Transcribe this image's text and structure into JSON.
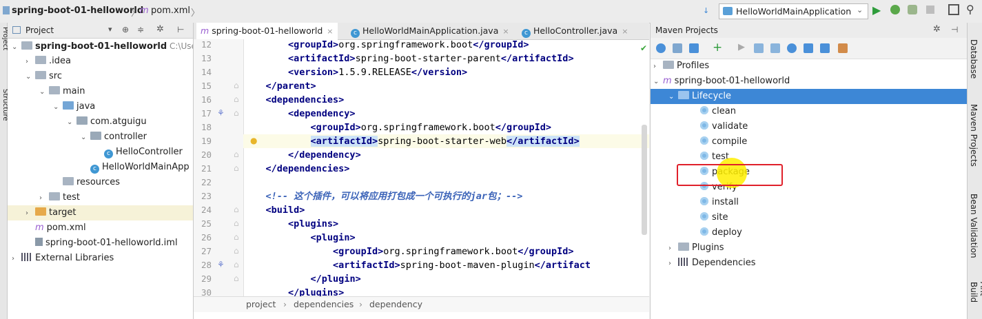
{
  "navbar": {
    "breadcrumb_project": "spring-boot-01-helloworld",
    "breadcrumb_file": "pom.xml",
    "run_config": "HelloWorldMainApplication"
  },
  "side_tabs": {
    "left": [
      "Project",
      "Structure"
    ],
    "right": [
      "Database",
      "Maven Projects",
      "Bean Validation",
      "Ant Build"
    ]
  },
  "project_panel": {
    "title": "Project",
    "tree": [
      {
        "label": "spring-boot-01-helloworld",
        "suffix": "C:\\Users",
        "arrow": "v",
        "icon": "folder",
        "bold": true
      },
      {
        "label": ".idea",
        "arrow": ">",
        "icon": "folder"
      },
      {
        "label": "src",
        "arrow": "v",
        "icon": "folder"
      },
      {
        "label": "main",
        "arrow": "v",
        "icon": "folder"
      },
      {
        "label": "java",
        "arrow": "v",
        "icon": "folder-blue"
      },
      {
        "label": "com.atguigu",
        "arrow": "v",
        "icon": "package"
      },
      {
        "label": "controller",
        "arrow": "v",
        "icon": "package"
      },
      {
        "label": "HelloController",
        "arrow": "",
        "icon": "class"
      },
      {
        "label": "HelloWorldMainApp",
        "arrow": "",
        "icon": "class"
      },
      {
        "label": "resources",
        "arrow": "",
        "icon": "folder"
      },
      {
        "label": "test",
        "arrow": ">",
        "icon": "folder"
      },
      {
        "label": "target",
        "arrow": ">",
        "icon": "folder-orange"
      },
      {
        "label": "pom.xml",
        "arrow": "",
        "icon": "maven"
      },
      {
        "label": "spring-boot-01-helloworld.iml",
        "arrow": "",
        "icon": "file"
      },
      {
        "label": "External Libraries",
        "arrow": ">",
        "icon": "library"
      }
    ]
  },
  "editor": {
    "tabs": [
      "spring-boot-01-helloworld",
      "HelloWorldMainApplication.java",
      "HelloController.java"
    ],
    "lines": [
      {
        "n": "12",
        "indent": "        ",
        "parts": [
          [
            "tg",
            "<groupId>"
          ],
          [
            "tx",
            "org.springframework.boot"
          ],
          [
            "tg",
            "</groupId>"
          ]
        ]
      },
      {
        "n": "13",
        "indent": "        ",
        "parts": [
          [
            "tg",
            "<artifactId>"
          ],
          [
            "tx",
            "spring-boot-starter-parent"
          ],
          [
            "tg",
            "</artifactId>"
          ]
        ]
      },
      {
        "n": "14",
        "indent": "        ",
        "parts": [
          [
            "tg",
            "<version>"
          ],
          [
            "tx",
            "1.5.9.RELEASE"
          ],
          [
            "tg",
            "</version>"
          ]
        ]
      },
      {
        "n": "15",
        "indent": "    ",
        "parts": [
          [
            "tg",
            "</parent>"
          ]
        ]
      },
      {
        "n": "16",
        "indent": "    ",
        "parts": [
          [
            "tg",
            "<dependencies>"
          ]
        ]
      },
      {
        "n": "17",
        "indent": "        ",
        "parts": [
          [
            "tg",
            "<dependency>"
          ]
        ]
      },
      {
        "n": "18",
        "indent": "            ",
        "parts": [
          [
            "tg",
            "<groupId>"
          ],
          [
            "tx",
            "org.springframework.boot"
          ],
          [
            "tg",
            "</groupId>"
          ]
        ]
      },
      {
        "n": "19",
        "indent": "            ",
        "parts": [
          [
            "tg hl",
            "<artifactId>"
          ],
          [
            "tx",
            "spring-boot-starter-web"
          ],
          [
            "tg hl",
            "</artifactId>"
          ]
        ]
      },
      {
        "n": "20",
        "indent": "        ",
        "parts": [
          [
            "tg",
            "</dependency>"
          ]
        ]
      },
      {
        "n": "21",
        "indent": "    ",
        "parts": [
          [
            "tg",
            "</dependencies>"
          ]
        ]
      },
      {
        "n": "22",
        "indent": "",
        "parts": []
      },
      {
        "n": "23",
        "indent": "    ",
        "parts": [
          [
            "cm",
            "<!-- 这个插件，可以将应用打包成一个可执行的jar包；-->"
          ]
        ]
      },
      {
        "n": "24",
        "indent": "    ",
        "parts": [
          [
            "tg",
            "<build>"
          ]
        ]
      },
      {
        "n": "25",
        "indent": "        ",
        "parts": [
          [
            "tg",
            "<plugins>"
          ]
        ]
      },
      {
        "n": "26",
        "indent": "            ",
        "parts": [
          [
            "tg",
            "<plugin>"
          ]
        ]
      },
      {
        "n": "27",
        "indent": "                ",
        "parts": [
          [
            "tg",
            "<groupId>"
          ],
          [
            "tx",
            "org.springframework.boot"
          ],
          [
            "tg",
            "</groupId>"
          ]
        ]
      },
      {
        "n": "28",
        "indent": "                ",
        "parts": [
          [
            "tg",
            "<artifactId>"
          ],
          [
            "tx",
            "spring-boot-maven-plugin"
          ],
          [
            "tg",
            "</artifact"
          ]
        ]
      },
      {
        "n": "29",
        "indent": "            ",
        "parts": [
          [
            "tg",
            "</plugin>"
          ]
        ]
      },
      {
        "n": "30",
        "indent": "        ",
        "parts": [
          [
            "tg",
            "</plugins>"
          ]
        ]
      }
    ],
    "breadcrumb": [
      "project",
      "dependencies",
      "dependency"
    ]
  },
  "maven_panel": {
    "title": "Maven Projects",
    "tree": [
      {
        "label": "Profiles",
        "arrow": ">",
        "level": 0,
        "icon": "folder"
      },
      {
        "label": "spring-boot-01-helloworld",
        "arrow": "v",
        "level": 0,
        "icon": "maven"
      },
      {
        "label": "Lifecycle",
        "arrow": "v",
        "level": 1,
        "icon": "folder",
        "selected": true
      },
      {
        "label": "clean",
        "level": 2,
        "icon": "gear"
      },
      {
        "label": "validate",
        "level": 2,
        "icon": "gear"
      },
      {
        "label": "compile",
        "level": 2,
        "icon": "gear"
      },
      {
        "label": "test",
        "level": 2,
        "icon": "gear"
      },
      {
        "label": "package",
        "level": 2,
        "icon": "gear",
        "highlighted": true
      },
      {
        "label": "verify",
        "level": 2,
        "icon": "gear"
      },
      {
        "label": "install",
        "level": 2,
        "icon": "gear"
      },
      {
        "label": "site",
        "level": 2,
        "icon": "gear"
      },
      {
        "label": "deploy",
        "level": 2,
        "icon": "gear"
      },
      {
        "label": "Plugins",
        "arrow": ">",
        "level": 1,
        "icon": "folder"
      },
      {
        "label": "Dependencies",
        "arrow": ">",
        "level": 1,
        "icon": "library"
      }
    ]
  },
  "colors": {
    "accent": "#3d87d6",
    "highlight_box": "#e0202a",
    "cursor": "#ffee00"
  }
}
